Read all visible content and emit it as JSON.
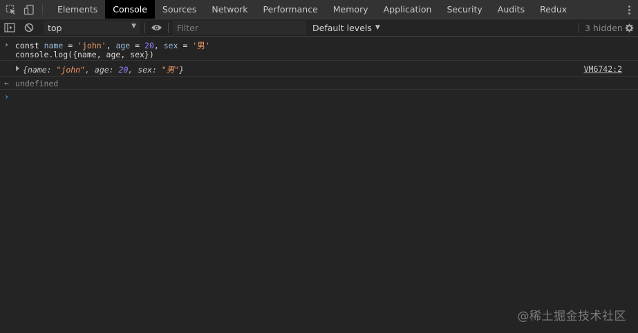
{
  "tabbar": {
    "icons": [
      "inspect-element-icon",
      "device-toggle-icon"
    ],
    "tabs": [
      {
        "label": "Elements",
        "active": false
      },
      {
        "label": "Console",
        "active": true
      },
      {
        "label": "Sources",
        "active": false
      },
      {
        "label": "Network",
        "active": false
      },
      {
        "label": "Performance",
        "active": false
      },
      {
        "label": "Memory",
        "active": false
      },
      {
        "label": "Application",
        "active": false
      },
      {
        "label": "Security",
        "active": false
      },
      {
        "label": "Audits",
        "active": false
      },
      {
        "label": "Redux",
        "active": false
      }
    ]
  },
  "toolbar": {
    "context": "top",
    "filter_placeholder": "Filter",
    "levels": "Default levels",
    "hidden_count": "3 hidden"
  },
  "console": {
    "input": {
      "line1": {
        "const": "const",
        "name_ident": "name",
        "eq1": " = ",
        "name_val": "'john'",
        "comma1": ", ",
        "age_ident": "age",
        "eq2": " = ",
        "age_val": "20",
        "comma2": ", ",
        "sex_ident": "sex",
        "eq3": " = ",
        "sex_val": "'男'"
      },
      "line2": "console.log({name, age, sex})"
    },
    "output": {
      "open": "{",
      "k1": "name: ",
      "v1": "\"john\"",
      "c1": ", ",
      "k2": "age: ",
      "v2": "20",
      "c2": ", ",
      "k3": "sex: ",
      "v3": "\"男\"",
      "close": "}",
      "source": "VM6742:2"
    },
    "result": "undefined"
  },
  "watermark": "@稀土掘金技术社区",
  "colors": {
    "background": "#242424",
    "tabbar": "#333333",
    "active_tab": "#000000",
    "string": "#f29766",
    "number": "#9980ff",
    "identifier": "#9bbbdc"
  }
}
